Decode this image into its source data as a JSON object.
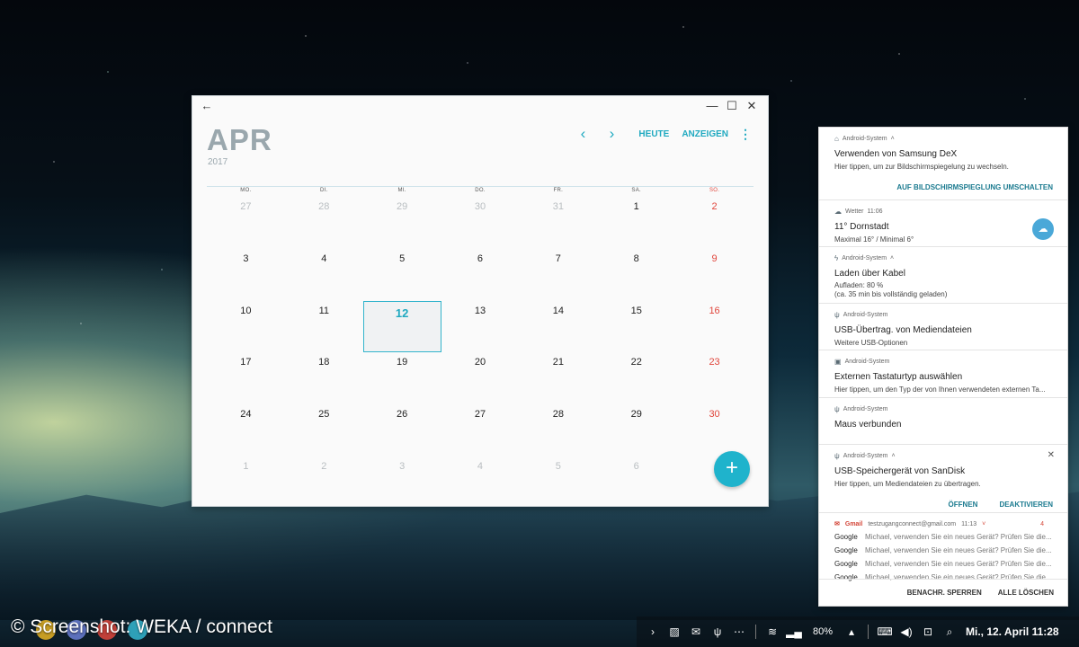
{
  "calendar": {
    "month": "APR",
    "year": "2017",
    "toolbar": {
      "today": "HEUTE",
      "view": "ANZEIGEN"
    },
    "weekdays": [
      "MO.",
      "DI.",
      "MI.",
      "DO.",
      "FR.",
      "SA.",
      "SO."
    ],
    "weeks": [
      [
        "27",
        "28",
        "29",
        "30",
        "31",
        "1",
        "2"
      ],
      [
        "3",
        "4",
        "5",
        "6",
        "7",
        "8",
        "9"
      ],
      [
        "10",
        "11",
        "12",
        "13",
        "14",
        "15",
        "16"
      ],
      [
        "17",
        "18",
        "19",
        "20",
        "21",
        "22",
        "23"
      ],
      [
        "24",
        "25",
        "26",
        "27",
        "28",
        "29",
        "30"
      ],
      [
        "1",
        "2",
        "3",
        "4",
        "5",
        "6",
        ""
      ]
    ]
  },
  "notifications": {
    "dex": {
      "app": "Android-System",
      "title": "Verwenden von Samsung DeX",
      "text": "Hier tippen, um zur Bildschirmspiegelung zu wechseln.",
      "action": "AUF BILDSCHIRMSPIEGLUNG UMSCHALTEN"
    },
    "weather": {
      "app": "Wetter",
      "time": "11:06",
      "title": "11° Dornstadt",
      "text": "Maximal 16° / Minimal 6°"
    },
    "charging": {
      "app": "Android-System",
      "title": "Laden über Kabel",
      "text1": "Aufladen: 80 %",
      "text2": "(ca. 35 min bis vollständig geladen)"
    },
    "usb_transfer": {
      "app": "Android-System",
      "title": "USB-Übertrag. von Mediendateien",
      "text": "Weitere USB-Optionen"
    },
    "keyboard": {
      "app": "Android-System",
      "title": "Externen Tastaturtyp auswählen",
      "text": "Hier tippen, um den Typ der von Ihnen verwendeten externen Ta..."
    },
    "mouse": {
      "app": "Android-System",
      "title": "Maus verbunden"
    },
    "sandisk": {
      "app": "Android-System",
      "title": "USB-Speichergerät von SanDisk",
      "text": "Hier tippen, um Mediendateien zu übertragen.",
      "open": "ÖFFNEN",
      "disable": "DEAKTIVIEREN"
    },
    "gmail": {
      "app": "Gmail",
      "account": "testzugangconnect@gmail.com",
      "time": "11:13",
      "count": "4",
      "messages": [
        {
          "sender": "Google",
          "text": "Michael, verwenden Sie ein neues Gerät? Prüfen Sie die..."
        },
        {
          "sender": "Google",
          "text": "Michael, verwenden Sie ein neues Gerät? Prüfen Sie die..."
        },
        {
          "sender": "Google",
          "text": "Michael, verwenden Sie ein neues Gerät? Prüfen Sie die..."
        },
        {
          "sender": "Google",
          "text": "Michael, verwenden Sie ein neues Gerät? Prüfen Sie die..."
        }
      ]
    },
    "footer": {
      "block": "BENACHR. SPERREN",
      "clear": "ALLE LÖSCHEN"
    }
  },
  "taskbar": {
    "watermark": "© Screenshot: WEKA / connect",
    "battery": "80%",
    "clock": "Mi., 12. April 11:28"
  }
}
